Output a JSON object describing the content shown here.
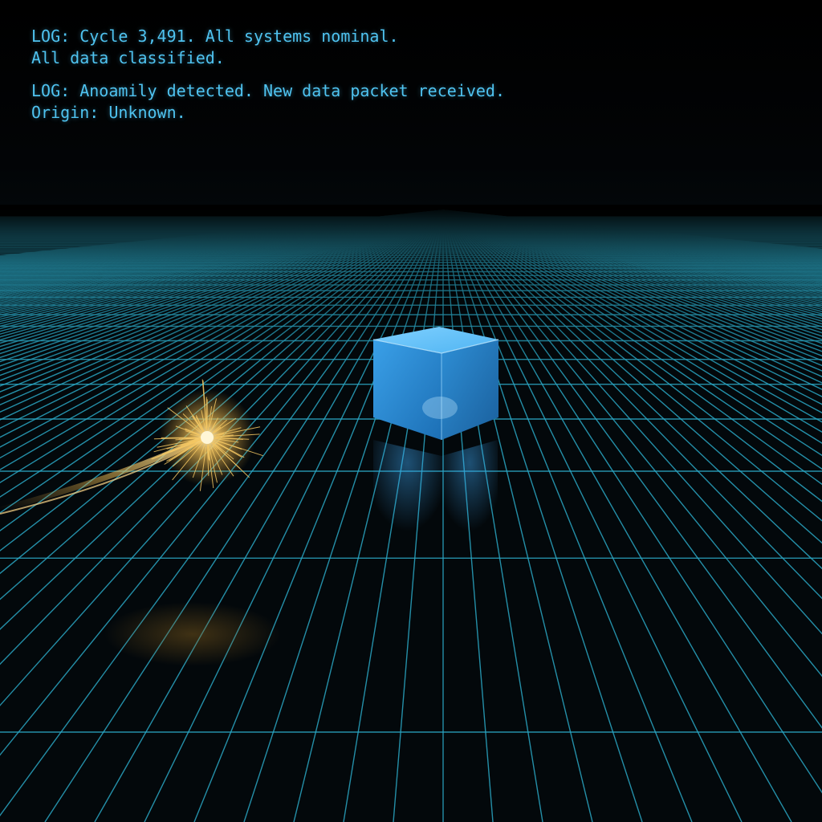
{
  "log": {
    "entries": [
      {
        "line1": "LOG: Cycle 3,491. All systems nominal.",
        "line2": "All data classified."
      },
      {
        "line1": "LOG: Anoamily detected. New data packet received.",
        "line2": "Origin: Unknown."
      }
    ]
  },
  "colors": {
    "text": "#4fc3f0",
    "grid": "#2aa7c4",
    "cube": "#3fa9f5",
    "spark": "#e8b84a",
    "background": "#000000"
  },
  "icons": {
    "cube": "glowing-blue-cube",
    "anomaly": "golden-spark-particle"
  }
}
